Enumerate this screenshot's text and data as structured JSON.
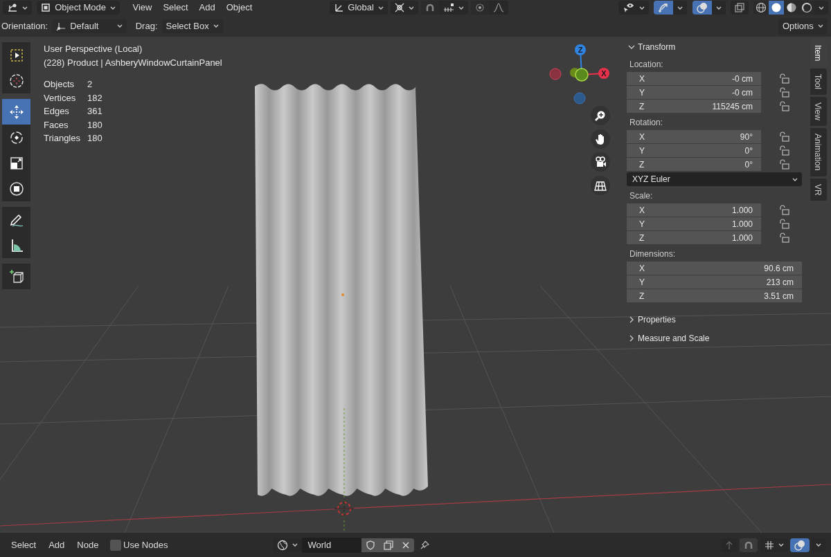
{
  "header": {
    "mode": "Object Mode",
    "menus": [
      "View",
      "Select",
      "Add",
      "Object"
    ],
    "transform_orientation": "Global",
    "snap": {
      "on": false
    },
    "proportional_editing": {
      "on": false
    },
    "gizmos": {
      "on": true
    },
    "overlays": {
      "on": true
    },
    "xray": {
      "on": false
    },
    "shading": [
      {
        "kind": "wireframe",
        "selected": false
      },
      {
        "kind": "solid",
        "selected": true
      },
      {
        "kind": "material",
        "selected": false
      },
      {
        "kind": "rendered",
        "selected": false
      }
    ]
  },
  "tool_settings": {
    "orientation_label": "Orientation:",
    "orientation": "Default",
    "drag_label": "Drag:",
    "drag": "Select Box",
    "options": "Options"
  },
  "toolbar": [
    {
      "kind": "select_box",
      "selected": false
    },
    {
      "kind": "cursor",
      "selected": false
    },
    {
      "kind": "move",
      "selected": true
    },
    {
      "kind": "rotate",
      "selected": false
    },
    {
      "kind": "scale",
      "selected": false
    },
    {
      "kind": "transform",
      "selected": false
    },
    {
      "kind": "annotate",
      "selected": false
    },
    {
      "kind": "measure",
      "selected": false
    },
    {
      "kind": "add_cube",
      "selected": false
    }
  ],
  "viewport_info": {
    "view": "User Perspective (Local)",
    "object": "(228) Product | AshberyWindowCurtainPanel",
    "stats": [
      {
        "label": "Objects",
        "value": "2"
      },
      {
        "label": "Vertices",
        "value": "182"
      },
      {
        "label": "Edges",
        "value": "361"
      },
      {
        "label": "Faces",
        "value": "180"
      },
      {
        "label": "Triangles",
        "value": "180"
      }
    ]
  },
  "gizmo": {
    "axes": [
      {
        "kind": "z",
        "label": "Z"
      },
      {
        "kind": "x",
        "label": "X"
      }
    ]
  },
  "sidebar": {
    "tabs": [
      {
        "label": "Item",
        "selected": true
      },
      {
        "label": "Tool",
        "selected": false
      },
      {
        "label": "View",
        "selected": false
      },
      {
        "label": "Animation",
        "selected": false
      },
      {
        "label": "VR",
        "selected": false
      }
    ],
    "transform": {
      "title": "Transform",
      "expanded": true,
      "groups": [
        {
          "kind": "fields",
          "label": "Location:",
          "rows": [
            {
              "axis": "X",
              "value": "-0 cm",
              "locked": false
            },
            {
              "axis": "Y",
              "value": "-0 cm",
              "locked": false
            },
            {
              "axis": "Z",
              "value": "115245 cm",
              "locked": false
            }
          ]
        },
        {
          "kind": "fields",
          "label": "Rotation:",
          "rows": [
            {
              "axis": "X",
              "value": "90°",
              "locked": false
            },
            {
              "axis": "Y",
              "value": "0°",
              "locked": false
            },
            {
              "axis": "Z",
              "value": "0°",
              "locked": false
            }
          ]
        },
        {
          "kind": "dropdown",
          "value": "XYZ Euler"
        },
        {
          "kind": "fields",
          "label": "Scale:",
          "rows": [
            {
              "axis": "X",
              "value": "1.000",
              "locked": false
            },
            {
              "axis": "Y",
              "value": "1.000",
              "locked": false
            },
            {
              "axis": "Z",
              "value": "1.000",
              "locked": false
            }
          ]
        },
        {
          "kind": "fields",
          "label": "Dimensions:",
          "rows": [
            {
              "axis": "X",
              "value": "90.6 cm"
            },
            {
              "axis": "Y",
              "value": "213 cm"
            },
            {
              "axis": "Z",
              "value": "3.51 cm"
            }
          ]
        }
      ]
    },
    "panels": [
      {
        "title": "Properties",
        "expanded": false
      },
      {
        "title": "Measure and Scale",
        "expanded": false
      }
    ]
  },
  "bottom_bar": {
    "menus": [
      "Select",
      "Add",
      "Node"
    ],
    "use_nodes": {
      "label": "Use Nodes",
      "checked": false
    },
    "world": "World"
  }
}
